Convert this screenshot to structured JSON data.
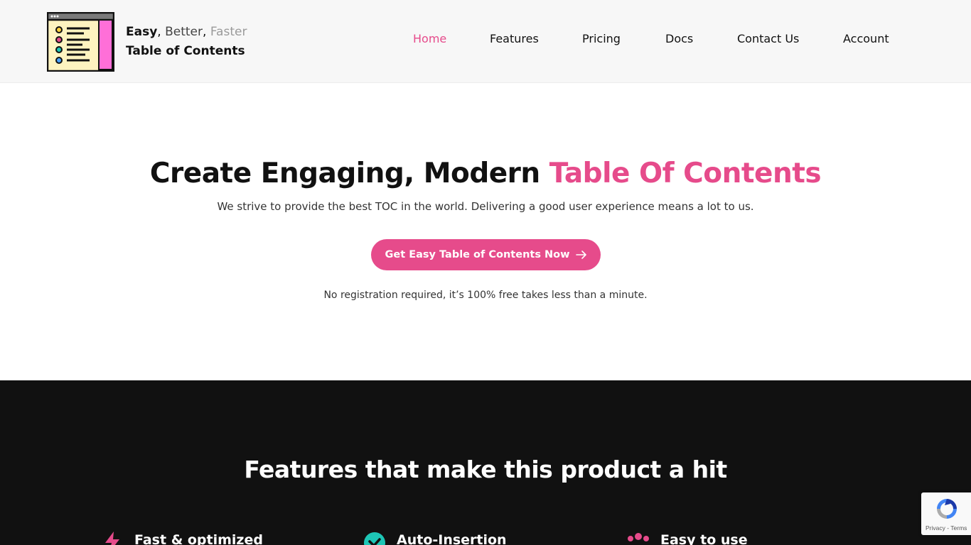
{
  "header": {
    "logo": {
      "line1_easy": "Easy",
      "line1_sep1": ", ",
      "line1_better": "Better",
      "line1_sep2": ", ",
      "line1_faster": "Faster",
      "line2": "Table of Contents"
    },
    "nav": {
      "home": "Home",
      "features": "Features",
      "pricing": "Pricing",
      "docs": "Docs",
      "contact": "Contact Us",
      "account": "Account",
      "active": "Home"
    }
  },
  "hero": {
    "title_main": "Create Engaging, Modern ",
    "title_accent": "Table Of Contents",
    "subtitle": "We strive to provide the best TOC in the world. Delivering a good user experience means a lot to us.",
    "cta_label": "Get Easy Table of Contents Now",
    "note": "No registration required, it’s 100% free takes less than a minute."
  },
  "features": {
    "title": "Features that make this product a hit",
    "items": [
      {
        "label": "Fast & optimized",
        "icon": "lightning-icon"
      },
      {
        "label": "Auto-Insertion",
        "icon": "check-circle-icon"
      },
      {
        "label": "Easy to use",
        "icon": "users-icon"
      }
    ]
  },
  "recaptcha": {
    "links": "Privacy - Terms"
  },
  "colors": {
    "accent": "#e64b8b",
    "header_bg": "#f7f7f7",
    "dark_section": "#111111",
    "check_icon": "#1ec6b6"
  }
}
